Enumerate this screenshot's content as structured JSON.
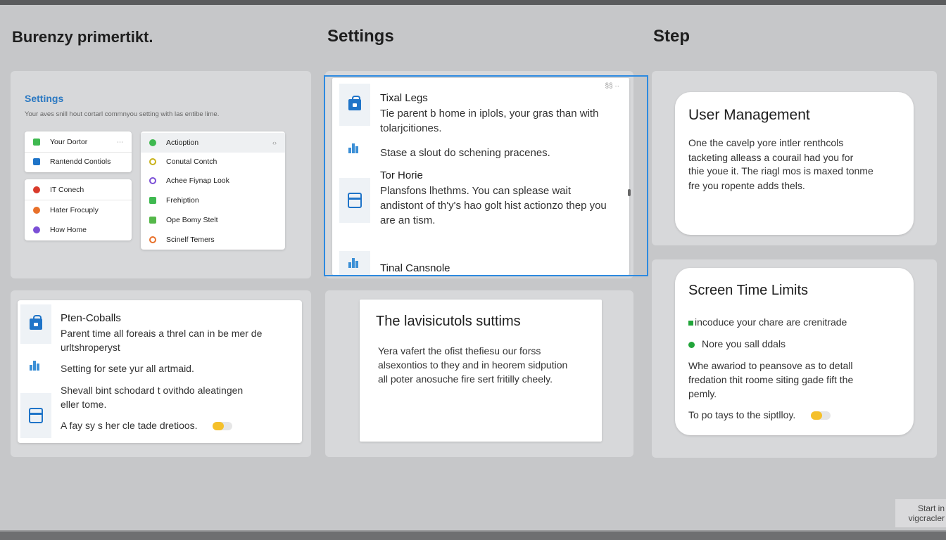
{
  "columns": {
    "left_title": "Burenzy primertikt.",
    "middle_title": "Settings",
    "right_title": "Step"
  },
  "settings_panel": {
    "title": "Settings",
    "subtitle": "Your aves snill hout cortarl commnyou setting with las entibe lime.",
    "left_group_1": [
      {
        "label": "Your Dortor",
        "icon": "square-green-icon",
        "color": "#3fb950"
      },
      {
        "label": "Rantendd Contiols",
        "icon": "square-blue-icon",
        "color": "#1f74c8"
      }
    ],
    "left_group_2": [
      {
        "label": "IT Conech",
        "icon": "dot-red-icon",
        "color": "#d93a2b"
      },
      {
        "label": "Hater Frocuply",
        "icon": "dot-orange-icon",
        "color": "#e8702a"
      },
      {
        "label": "How Home",
        "icon": "dot-purple-icon",
        "color": "#7b4fd6"
      }
    ],
    "right_group": [
      {
        "label": "Actioption",
        "icon": "dot-green-icon",
        "color": "#3fb950",
        "chevron": "‹›"
      },
      {
        "label": "Conutal Contch",
        "icon": "ring-yellow-icon",
        "color": "#c9b21a"
      },
      {
        "label": "Achee Fiynap Look",
        "icon": "ring-purple-icon",
        "color": "#7b4fd6"
      },
      {
        "label": "Frehiption",
        "icon": "square-green-icon",
        "color": "#3fb950"
      },
      {
        "label": "Ope Bomy Stelt",
        "icon": "square-green-icon",
        "color": "#55b84a"
      },
      {
        "label": "Scinelf Temers",
        "icon": "ring-orange-icon",
        "color": "#e8702a"
      }
    ]
  },
  "middle_list": {
    "corner_label": "§§ ··",
    "item1_title": "Tixal Legs",
    "item1_body": "Tie parent b home in iplols, your gras than with tolarjcitiones.",
    "item2_body": "Stase a slout do schening pracenes.",
    "item3_title": "Tor Horie",
    "item3_body": "Plansfons lhethms. You can splease wait andistont of th'y's hao golt hist actionzo thep you are an tism.",
    "item4_title": "Tinal Cansnole"
  },
  "bottom_left": {
    "title": "Pten-Coballs",
    "line1": "Parent time all foreais a threl can in be mer de",
    "line2": "urltshroperyst",
    "line3": "Setting for sete yur all artmaid.",
    "line4": "Shevall bint schodard t ovithdo aleatingen",
    "line5": "eller tome.",
    "line6": "A fay sy s her cle tade dretioos."
  },
  "bottom_middle": {
    "title": "The lavisicutols suttims",
    "body1": "Yera vafert the ofist thefiesu our forss",
    "body2": "alsexontios to they and in heorem sidpution",
    "body3": "all poter anosuche fire sert fritilly cheely."
  },
  "user_management": {
    "title": "User Management",
    "body1": "One the cavelp yore intler renthcols",
    "body2": "tacketing alleass a courail had you for",
    "body3": "thie youe it. The riagl mos is maxed tonme",
    "body4": "fre you ropente adds thels."
  },
  "screen_time": {
    "title": "Screen Time Limits",
    "line1": "incoduce your chare are crenitrade",
    "line2": "Nore you sall ddals",
    "line3": "Whe awariod to peansove as to detall",
    "line4": "fredation thit roome siting gade fift the",
    "line5": "pemly.",
    "line6": "To po tays to the siptlloy."
  },
  "watermark": {
    "line1": "Start in",
    "line2": "vigcracler"
  },
  "colors": {
    "accent": "#2a78c2",
    "selection": "#2d8ae0",
    "toggle_on": "#f5c02a",
    "status_green": "#22a53a"
  }
}
